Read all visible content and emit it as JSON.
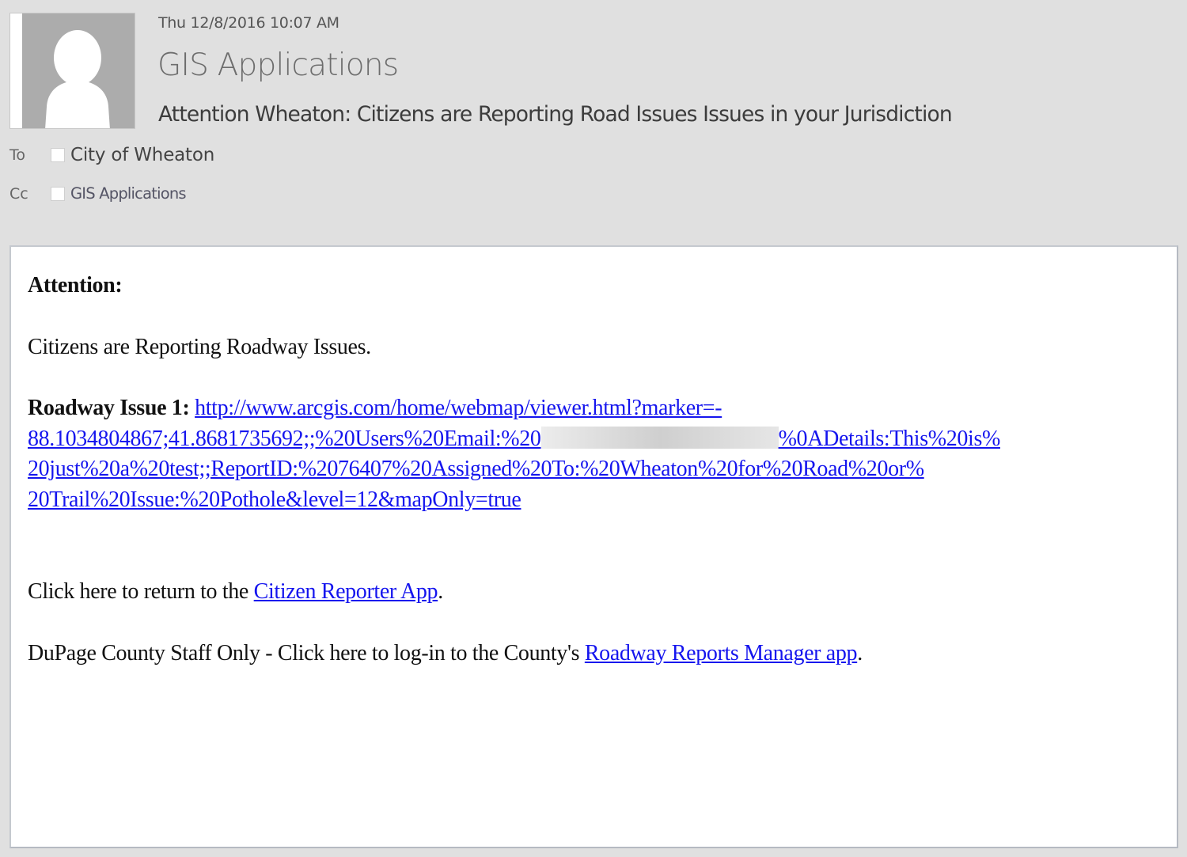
{
  "header": {
    "date": "Thu 12/8/2016 10:07 AM",
    "sender": "GIS Applications",
    "subject": "Attention Wheaton: Citizens are Reporting Road Issues Issues in your Jurisdiction",
    "avatar_icon": "person-silhouette-icon"
  },
  "recipients": {
    "to_label": "To",
    "to_name": "City of Wheaton",
    "cc_label": "Cc",
    "cc_name": "GIS Applications"
  },
  "body": {
    "greeting": "Attention:",
    "intro": "Citizens are Reporting Roadway Issues.",
    "issue_label": "Roadway Issue 1:",
    "issue_link_lines": [
      "http://www.arcgis.com/home/webmap/viewer.html?marker=-",
      "88.1034804867;41.8681735692;;%20Users%20Email:%20",
      "%0ADetails:This%20is%",
      "20just%20a%20test;;ReportID:%2076407%20Assigned%20To:%20Wheaton%20for%20Road%20or%",
      "20Trail%20Issue:%20Pothole&level=12&mapOnly=true"
    ],
    "return_prefix": "Click here to return to the ",
    "return_link": "Citizen Reporter App",
    "return_suffix": ".",
    "staff_prefix": "DuPage County Staff Only - Click here to log-in to the County's ",
    "staff_link": "Roadway Reports Manager app",
    "staff_suffix": "."
  },
  "colors": {
    "link": "#1515ee",
    "background": "#e0e0e0",
    "avatar": "#acacac"
  }
}
